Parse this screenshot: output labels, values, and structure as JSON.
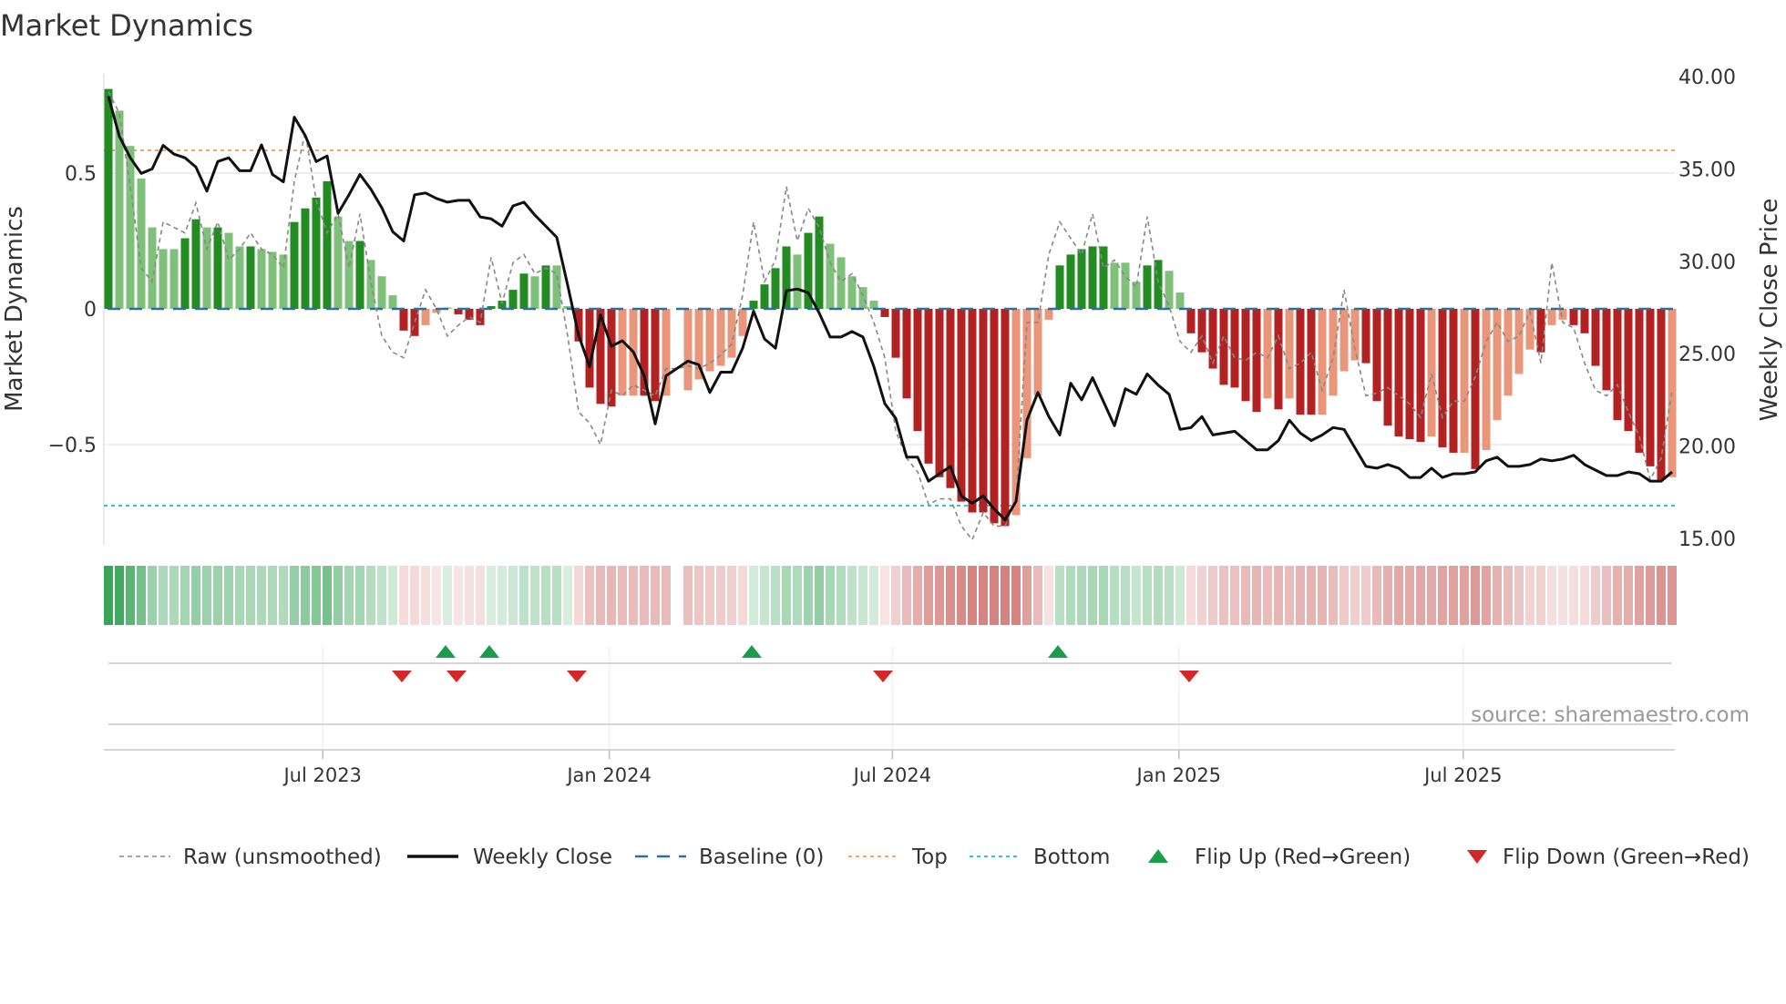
{
  "chart_data": {
    "type": "bar",
    "title": "Market Dynamics",
    "ylabel": "Market Dynamics",
    "y2label": "Weekly Close Price",
    "ylim": [
      -0.87,
      0.87
    ],
    "y2lim": [
      15,
      40
    ],
    "yticks": [
      {
        "v": 0.5,
        "label": "0.5"
      },
      {
        "v": 0,
        "label": "0"
      },
      {
        "v": -0.5,
        "label": "−0.5"
      }
    ],
    "y2ticks": [
      {
        "v": 40,
        "label": "40.00"
      },
      {
        "v": 35,
        "label": "35.00"
      },
      {
        "v": 30,
        "label": "30.00"
      },
      {
        "v": 25,
        "label": "25.00"
      },
      {
        "v": 20,
        "label": "20.00"
      },
      {
        "v": 15,
        "label": "15.00"
      }
    ],
    "xticks": [
      {
        "week": 19.6,
        "label": "Jul 2023"
      },
      {
        "week": 45.8,
        "label": "Jan 2024"
      },
      {
        "week": 71.7,
        "label": "Jul 2024"
      },
      {
        "week": 97.9,
        "label": "Jan 2025"
      },
      {
        "week": 123.9,
        "label": "Jul 2025"
      }
    ],
    "top_level": 0.584,
    "bottom_level": -0.725,
    "baseline": 0,
    "grid": true,
    "legend_position": "bottom",
    "colors": {
      "strong_green": "#228b22",
      "weak_green": "#7fc07b",
      "strong_red": "#b22222",
      "weak_red": "#e9967a",
      "close": "#111111",
      "raw": "#888888",
      "baseline": "#2a6f9e",
      "top": "#f0a868",
      "bottom": "#2bc6d8",
      "flip_up": "#1a9e4a",
      "flip_down": "#d62728"
    },
    "momentum": [
      0.81,
      0.73,
      0.6,
      0.48,
      0.3,
      0.22,
      0.22,
      0.26,
      0.33,
      0.3,
      0.3,
      0.28,
      0.23,
      0.23,
      0.22,
      0.21,
      0.2,
      0.32,
      0.37,
      0.41,
      0.47,
      0.34,
      0.25,
      0.25,
      0.18,
      0.12,
      0.05,
      -0.08,
      -0.1,
      -0.06,
      -0.015,
      0.005,
      -0.02,
      -0.04,
      -0.06,
      0.01,
      0.03,
      0.07,
      0.13,
      0.12,
      0.16,
      0.16,
      0.01,
      -0.12,
      -0.29,
      -0.35,
      -0.36,
      -0.32,
      -0.32,
      -0.32,
      -0.34,
      -0.32,
      null,
      -0.3,
      -0.26,
      -0.23,
      -0.21,
      -0.18,
      -0.1,
      0.03,
      0.09,
      0.15,
      0.23,
      0.2,
      0.28,
      0.34,
      0.24,
      0.19,
      0.12,
      0.08,
      0.03,
      -0.03,
      -0.18,
      -0.33,
      -0.45,
      -0.57,
      -0.62,
      -0.66,
      -0.71,
      -0.75,
      -0.75,
      -0.79,
      -0.8,
      -0.76,
      -0.55,
      -0.32,
      -0.04,
      0.16,
      0.2,
      0.22,
      0.23,
      0.23,
      0.17,
      0.17,
      0.1,
      0.16,
      0.18,
      0.14,
      0.06,
      -0.09,
      -0.16,
      -0.22,
      -0.28,
      -0.29,
      -0.34,
      -0.38,
      -0.33,
      -0.37,
      -0.33,
      -0.39,
      -0.39,
      -0.39,
      -0.32,
      -0.23,
      -0.19,
      -0.2,
      -0.34,
      -0.43,
      -0.47,
      -0.48,
      -0.49,
      -0.47,
      -0.51,
      -0.53,
      -0.53,
      -0.59,
      -0.52,
      -0.41,
      -0.32,
      -0.24,
      -0.15,
      -0.16,
      -0.06,
      -0.04,
      -0.06,
      -0.09,
      -0.21,
      -0.3,
      -0.41,
      -0.45,
      -0.53,
      -0.58,
      -0.63,
      -0.62
    ],
    "strength": [
      "D",
      "L",
      "L",
      "L",
      "L",
      "L",
      "L",
      "D",
      "D",
      "L",
      "D",
      "L",
      "L",
      "D",
      "L",
      "L",
      "L",
      "D",
      "D",
      "D",
      "D",
      "L",
      "L",
      "D",
      "L",
      "L",
      "L",
      "R",
      "R",
      "S",
      "S",
      "L",
      "R",
      "R",
      "R",
      "D",
      "D",
      "D",
      "D",
      "L",
      "D",
      "L",
      "L",
      "R",
      "R",
      "R",
      "R",
      "S",
      "S",
      "R",
      "R",
      "S",
      null,
      "S",
      "S",
      "S",
      "S",
      "S",
      "S",
      "D",
      "D",
      "D",
      "D",
      "L",
      "D",
      "D",
      "L",
      "L",
      "L",
      "L",
      "L",
      "R",
      "R",
      "R",
      "R",
      "R",
      "R",
      "R",
      "R",
      "R",
      "R",
      "R",
      "R",
      "S",
      "S",
      "S",
      "S",
      "D",
      "D",
      "D",
      "D",
      "D",
      "L",
      "L",
      "L",
      "D",
      "D",
      "L",
      "L",
      "R",
      "R",
      "R",
      "R",
      "R",
      "R",
      "R",
      "S",
      "R",
      "S",
      "R",
      "R",
      "S",
      "S",
      "S",
      "S",
      "R",
      "R",
      "R",
      "R",
      "R",
      "R",
      "S",
      "R",
      "R",
      "S",
      "R",
      "S",
      "S",
      "S",
      "S",
      "S",
      "R",
      "S",
      "S",
      "R",
      "R",
      "R",
      "R",
      "R",
      "R",
      "R",
      "R",
      "R",
      "S"
    ],
    "raw": [
      0.8,
      0.72,
      0.45,
      0.15,
      0.1,
      0.32,
      0.3,
      0.28,
      0.39,
      0.22,
      0.32,
      0.18,
      0.22,
      0.28,
      0.22,
      0.2,
      0.15,
      0.47,
      0.65,
      0.4,
      0.28,
      0.35,
      0.15,
      0.35,
      0.1,
      -0.1,
      -0.16,
      -0.18,
      -0.05,
      0.07,
      0.0,
      -0.1,
      -0.06,
      -0.03,
      -0.05,
      0.19,
      0.02,
      0.17,
      0.2,
      0.13,
      0.15,
      0.13,
      -0.1,
      -0.38,
      -0.42,
      -0.5,
      -0.3,
      -0.32,
      -0.28,
      -0.3,
      -0.32,
      -0.22,
      -0.22,
      -0.21,
      -0.22,
      -0.2,
      -0.17,
      -0.13,
      0.05,
      0.32,
      0.1,
      0.18,
      0.45,
      0.25,
      0.37,
      0.3,
      0.17,
      0.1,
      0.13,
      0.05,
      -0.05,
      -0.18,
      -0.45,
      -0.55,
      -0.6,
      -0.72,
      -0.7,
      -0.7,
      -0.8,
      -0.85,
      -0.75,
      -0.8,
      -0.8,
      -0.7,
      -0.05,
      -0.05,
      0.2,
      0.32,
      0.26,
      0.2,
      0.35,
      0.15,
      0.18,
      0.12,
      0.08,
      0.34,
      0.1,
      0.01,
      -0.12,
      -0.16,
      -0.1,
      -0.2,
      -0.1,
      -0.18,
      -0.19,
      -0.16,
      -0.18,
      -0.1,
      -0.22,
      -0.2,
      -0.16,
      -0.3,
      -0.18,
      0.07,
      -0.15,
      -0.32,
      -0.31,
      -0.29,
      -0.32,
      -0.35,
      -0.4,
      -0.24,
      -0.4,
      -0.34,
      -0.34,
      -0.25,
      -0.12,
      -0.05,
      -0.12,
      -0.1,
      -0.01,
      -0.2,
      0.17,
      -0.05,
      -0.07,
      -0.2,
      -0.3,
      -0.32,
      -0.28,
      -0.38,
      -0.47,
      -0.63,
      -0.55,
      -0.3
    ],
    "weekly_close": [
      38.93,
      36.76,
      35.6,
      34.76,
      35.0,
      36.27,
      35.8,
      35.6,
      35.1,
      33.8,
      35.4,
      35.6,
      34.9,
      34.9,
      36.3,
      34.7,
      34.3,
      37.8,
      36.8,
      35.4,
      35.7,
      32.6,
      33.6,
      34.7,
      33.9,
      32.9,
      31.6,
      31.1,
      33.6,
      33.7,
      33.4,
      33.2,
      33.3,
      33.3,
      32.4,
      32.3,
      31.9,
      33.0,
      33.2,
      32.5,
      31.9,
      31.3,
      28.7,
      26.0,
      24.3,
      27.1,
      25.4,
      25.7,
      25.1,
      23.8,
      21.2,
      23.8,
      24.2,
      24.6,
      24.4,
      22.9,
      24.0,
      24.0,
      25.3,
      27.3,
      25.8,
      25.3,
      28.4,
      28.5,
      28.3,
      27.2,
      25.9,
      25.9,
      26.2,
      25.9,
      24.3,
      22.3,
      21.5,
      19.4,
      19.4,
      18.1,
      18.5,
      18.9,
      17.3,
      16.9,
      17.3,
      16.6,
      16.0,
      17.0,
      21.4,
      22.9,
      21.6,
      20.6,
      23.4,
      22.5,
      23.7,
      22.4,
      21.1,
      23.1,
      22.8,
      23.9,
      23.3,
      22.8,
      20.9,
      21.0,
      21.6,
      20.6,
      20.7,
      20.8,
      20.3,
      19.8,
      19.8,
      20.3,
      21.4,
      20.7,
      20.3,
      20.6,
      21.0,
      20.9,
      19.9,
      18.9,
      18.8,
      19.0,
      18.8,
      18.3,
      18.3,
      18.8,
      18.3,
      18.5,
      18.5,
      18.6,
      19.2,
      19.4,
      18.9,
      18.9,
      19.0,
      19.3,
      19.2,
      19.3,
      19.5,
      19.0,
      18.7,
      18.4,
      18.4,
      18.6,
      18.5,
      18.1,
      18.1,
      18.6
    ],
    "flip_up_weeks": [
      31,
      35,
      59,
      87
    ],
    "flip_down_weeks": [
      27,
      32,
      43,
      71,
      99
    ],
    "source": "source: sharemaestro.com",
    "legend": [
      {
        "label": "Raw (unsmoothed)",
        "kind": "raw"
      },
      {
        "label": "Weekly Close",
        "kind": "close"
      },
      {
        "label": "Baseline (0)",
        "kind": "baseline"
      },
      {
        "label": "Top",
        "kind": "top"
      },
      {
        "label": "Bottom",
        "kind": "bottom"
      },
      {
        "label": "Flip Up (Red→Green)",
        "kind": "up"
      },
      {
        "label": "Flip Down (Green→Red)",
        "kind": "down"
      }
    ]
  }
}
